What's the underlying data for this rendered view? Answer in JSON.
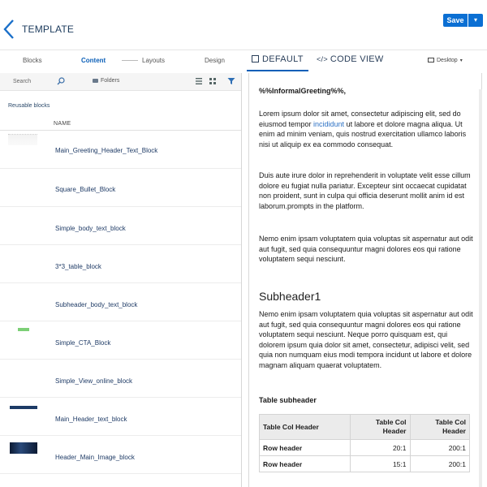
{
  "header": {
    "title": "TEMPLATE",
    "save_label": "Save"
  },
  "tabs": {
    "blocks": "Blocks",
    "content": "Content",
    "layouts": "Layouts",
    "design": "Design",
    "default_view": "DEFAULT",
    "code_view": "CODE VIEW",
    "device": "Desktop"
  },
  "toolbar": {
    "search_placeholder": "Search",
    "folders_label": "Folders"
  },
  "library": {
    "section_label": "Reusable blocks",
    "column_header": "NAME",
    "items": [
      "Main_Greeting_Header_Text_Block",
      "Square_Bullet_Block",
      "Simple_body_text_block",
      "3*3_table_block",
      "Subheader_body_text_block",
      "Simple_CTA_Block",
      "Simple_View_online_block",
      "Main_Header_text_block",
      "Header_Main_Image_block"
    ]
  },
  "preview": {
    "greeting": "%%InformalGreeting%%,",
    "p1_before": "Lorem ipsum dolor sit amet, consectetur adipiscing elit, sed do eiusmod tempor ",
    "p1_link": "incididunt",
    "p1_after": " ut labore et dolore magna aliqua. Ut enim ad minim veniam, quis nostrud exercitation ullamco laboris nisi ut aliquip ex ea commodo consequat.",
    "p2": "Duis aute irure dolor in reprehenderit in voluptate velit esse cillum dolore eu fugiat nulla pariatur. Excepteur sint occaecat cupidatat non proident, sunt in culpa qui officia deserunt mollit anim id est laborum.prompts in the platform.",
    "p3": "Nemo enim ipsam voluptatem quia voluptas sit aspernatur aut odit aut fugit, sed quia consequuntur magni dolores eos qui ratione voluptatem sequi nesciunt.",
    "subheader": "Subheader1",
    "p4": "Nemo enim ipsam voluptatem quia voluptas sit aspernatur aut odit aut fugit, sed quia consequuntur magni dolores eos qui ratione voluptatem sequi nesciunt. Neque porro quisquam est, qui dolorem ipsum quia dolor sit amet, consectetur, adipisci velit, sed quia non numquam eius modi tempora incidunt ut labore et dolore magnam aliquam quaerat voluptatem.",
    "table_subheader": "Table subheader",
    "table": {
      "headers": [
        "Table Col Header",
        "Table Col Header",
        "Table Col Header"
      ],
      "rows": [
        [
          "Row header",
          "20:1",
          "200:1"
        ],
        [
          "Row header",
          "15:1",
          "200:1"
        ]
      ]
    }
  },
  "colors": {
    "accent": "#0b6fd3",
    "link": "#2d72c4"
  }
}
